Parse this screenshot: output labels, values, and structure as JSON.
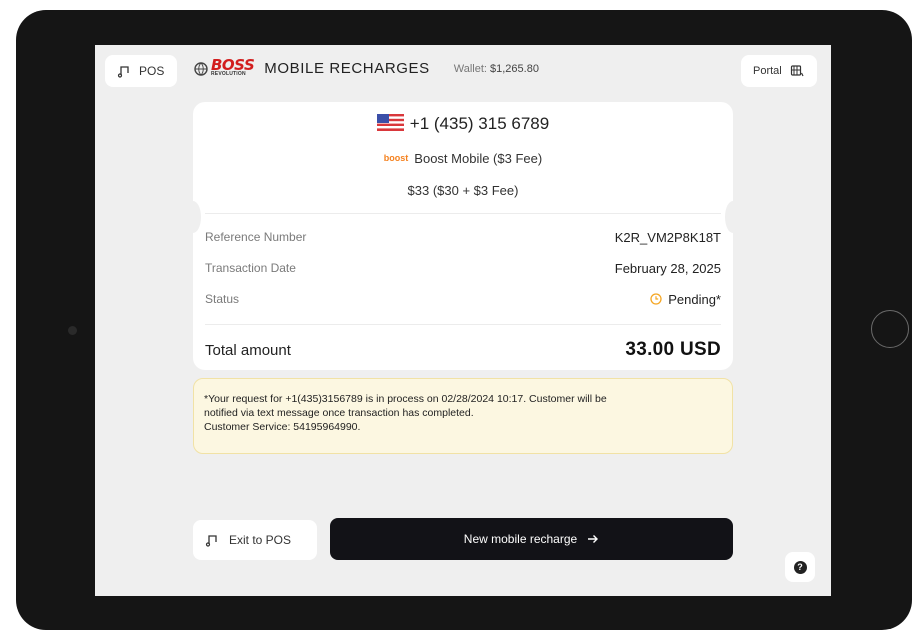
{
  "header": {
    "pos_label": "POS",
    "brand_logo_text": "BOSS",
    "brand_logo_sub": "REVOLUTION",
    "title": "MOBILE RECHARGES",
    "wallet_label": "Wallet:",
    "wallet_value": "$1,265.80",
    "portal_label": "Portal"
  },
  "receipt": {
    "phone": "+1 (435) 315 6789",
    "carrier_logo": "boost",
    "carrier": "Boost Mobile ($3 Fee)",
    "amount_summary": "$33 ($30 + $3 Fee)",
    "details": [
      {
        "label": "Reference Number",
        "value": "K2R_VM2P8K18T"
      },
      {
        "label": "Transaction Date",
        "value": "February 28, 2025"
      },
      {
        "label": "Status",
        "value": "Pending*"
      }
    ],
    "total_label": "Total amount",
    "total_value": "33.00 USD"
  },
  "notice": {
    "line1": "*Your request for +1(435)3156789 is in process on 02/28/2024 10:17. Customer will be",
    "line2": "notified via text message once transaction has completed.",
    "line3": "Customer Service: 54195964990."
  },
  "actions": {
    "exit_label": "Exit to POS",
    "new_label": "New mobile recharge",
    "help_symbol": "?"
  },
  "colors": {
    "brand_red": "#d21e1e",
    "primary_button": "#121217",
    "pending": "#f5a623",
    "notice_bg": "#fcf7e1",
    "boost_orange": "#f58220"
  },
  "icons": [
    "pos-icon",
    "portal-icon",
    "flag-us-icon",
    "clock-icon",
    "arrow-right-icon",
    "help-icon"
  ]
}
